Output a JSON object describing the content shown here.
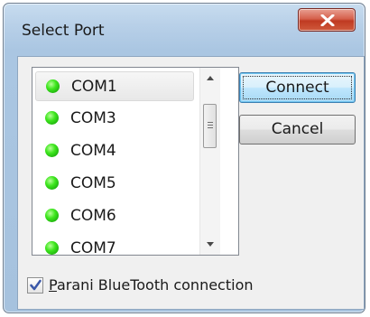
{
  "window": {
    "title": "Select Port"
  },
  "title_bar": {
    "close_icon": "close-x-icon"
  },
  "port_list": {
    "items": [
      {
        "label": "COM1",
        "status_icon": "green-led-icon",
        "selected": true
      },
      {
        "label": "COM3",
        "status_icon": "green-led-icon",
        "selected": false
      },
      {
        "label": "COM4",
        "status_icon": "green-led-icon",
        "selected": false
      },
      {
        "label": "COM5",
        "status_icon": "green-led-icon",
        "selected": false
      },
      {
        "label": "COM6",
        "status_icon": "green-led-icon",
        "selected": false
      },
      {
        "label": "COM7",
        "status_icon": "green-led-icon",
        "selected": false
      }
    ],
    "scroll_up_icon": "scroll-up-arrow-icon",
    "scroll_down_icon": "scroll-down-arrow-icon"
  },
  "buttons": {
    "connect": "Connect",
    "cancel": "Cancel"
  },
  "bluetooth_option": {
    "checked": true,
    "mnemonic": "P",
    "label_rest": "arani BlueTooth connection"
  },
  "colors": {
    "led": "#2ed410",
    "close_button": "#c8452e"
  }
}
